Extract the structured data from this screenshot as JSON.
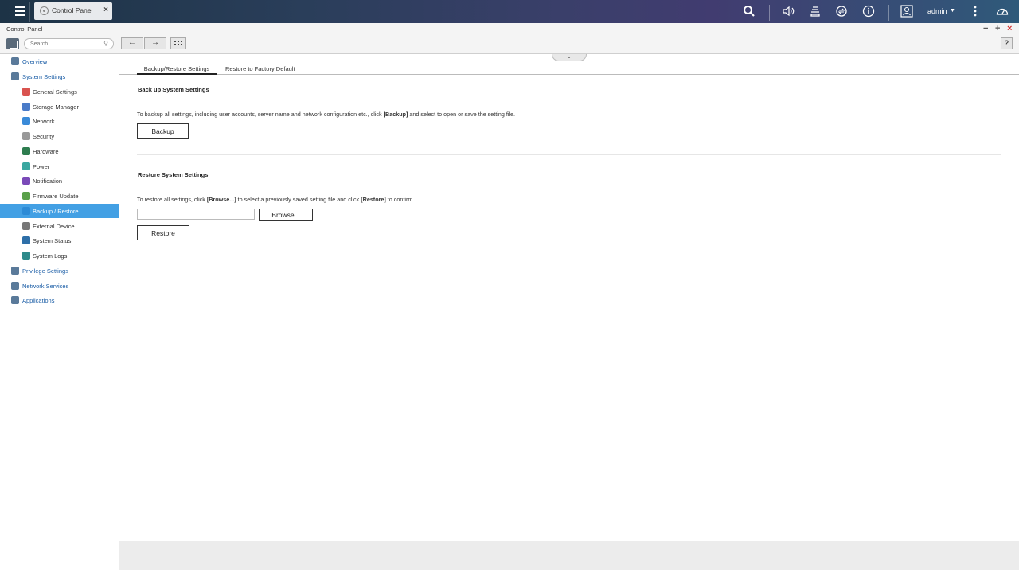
{
  "topbar": {
    "tab_label": "Control Panel",
    "tab_close": "×",
    "user": "admin",
    "user_caret": "▼"
  },
  "window": {
    "title": "Control Panel",
    "minimize": "−",
    "maximize": "+",
    "close": "×"
  },
  "toolbar": {
    "search_placeholder": "Search",
    "back": "←",
    "forward": "→",
    "help": "?"
  },
  "sidebar": {
    "items": [
      {
        "label": "Overview",
        "level": "top",
        "icon": "overview-icon",
        "color": "#5a7a9a"
      },
      {
        "label": "System Settings",
        "level": "top",
        "icon": "gear-icon",
        "color": "#5a7a9a"
      },
      {
        "label": "General Settings",
        "level": "sub",
        "icon": "general-settings-icon",
        "color": "#d9534f"
      },
      {
        "label": "Storage Manager",
        "level": "sub",
        "icon": "storage-icon",
        "color": "#4a7bc8"
      },
      {
        "label": "Network",
        "level": "sub",
        "icon": "network-icon",
        "color": "#3a8ad8"
      },
      {
        "label": "Security",
        "level": "sub",
        "icon": "lock-icon",
        "color": "#999999"
      },
      {
        "label": "Hardware",
        "level": "sub",
        "icon": "hardware-icon",
        "color": "#2e7d4f"
      },
      {
        "label": "Power",
        "level": "sub",
        "icon": "power-icon",
        "color": "#3aa7a0"
      },
      {
        "label": "Notification",
        "level": "sub",
        "icon": "notification-icon",
        "color": "#7a4ab8"
      },
      {
        "label": "Firmware Update",
        "level": "sub",
        "icon": "firmware-icon",
        "color": "#5aa04a"
      },
      {
        "label": "Backup / Restore",
        "level": "sub",
        "icon": "backup-restore-icon",
        "color": "#2d8bd6",
        "active": true
      },
      {
        "label": "External Device",
        "level": "sub",
        "icon": "external-device-icon",
        "color": "#777777"
      },
      {
        "label": "System Status",
        "level": "sub",
        "icon": "system-status-icon",
        "color": "#2e6fa8"
      },
      {
        "label": "System Logs",
        "level": "sub",
        "icon": "system-logs-icon",
        "color": "#2e8a8a"
      },
      {
        "label": "Privilege Settings",
        "level": "top",
        "icon": "user-icon",
        "color": "#5a7a9a"
      },
      {
        "label": "Network Services",
        "level": "top",
        "icon": "globe-icon",
        "color": "#5a7a9a"
      },
      {
        "label": "Applications",
        "level": "top",
        "icon": "applications-icon",
        "color": "#5a7a9a"
      }
    ]
  },
  "main": {
    "collapse": "⌄",
    "tabs": [
      {
        "label": "Backup/Restore Settings"
      },
      {
        "label": "Restore to Factory Default"
      }
    ],
    "backup": {
      "title": "Back up System Settings",
      "desc_pre": "To backup all settings, including user accounts, server name and network configuration etc., click ",
      "desc_bold": "[Backup]",
      "desc_post": " and select to open or save the setting file.",
      "button": "Backup"
    },
    "restore": {
      "title": "Restore System Settings",
      "desc_pre": "To restore all settings, click ",
      "desc_bold1": "[Browse...]",
      "desc_mid": " to select a previously saved setting file and click ",
      "desc_bold2": "[Restore]",
      "desc_post": " to confirm.",
      "file_value": "",
      "browse_button": "Browse...",
      "restore_button": "Restore"
    }
  }
}
